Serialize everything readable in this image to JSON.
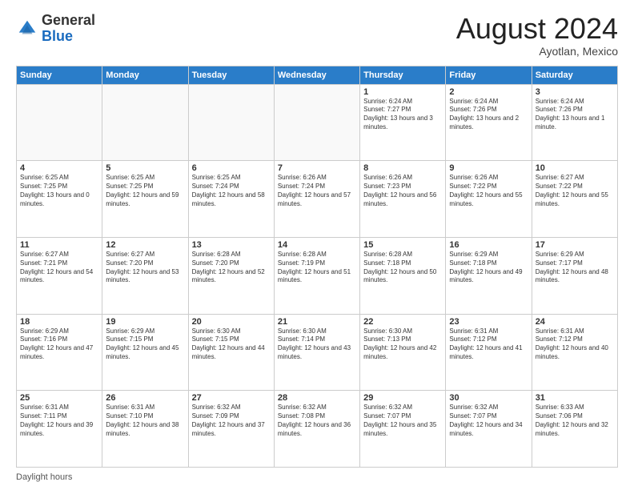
{
  "header": {
    "logo_general": "General",
    "logo_blue": "Blue",
    "month_title": "August 2024",
    "location": "Ayotlan, Mexico"
  },
  "footer": {
    "label": "Daylight hours"
  },
  "days_of_week": [
    "Sunday",
    "Monday",
    "Tuesday",
    "Wednesday",
    "Thursday",
    "Friday",
    "Saturday"
  ],
  "weeks": [
    [
      {
        "day": "",
        "sunrise": "",
        "sunset": "",
        "daylight": ""
      },
      {
        "day": "",
        "sunrise": "",
        "sunset": "",
        "daylight": ""
      },
      {
        "day": "",
        "sunrise": "",
        "sunset": "",
        "daylight": ""
      },
      {
        "day": "",
        "sunrise": "",
        "sunset": "",
        "daylight": ""
      },
      {
        "day": "1",
        "sunrise": "Sunrise: 6:24 AM",
        "sunset": "Sunset: 7:27 PM",
        "daylight": "Daylight: 13 hours and 3 minutes."
      },
      {
        "day": "2",
        "sunrise": "Sunrise: 6:24 AM",
        "sunset": "Sunset: 7:26 PM",
        "daylight": "Daylight: 13 hours and 2 minutes."
      },
      {
        "day": "3",
        "sunrise": "Sunrise: 6:24 AM",
        "sunset": "Sunset: 7:26 PM",
        "daylight": "Daylight: 13 hours and 1 minute."
      }
    ],
    [
      {
        "day": "4",
        "sunrise": "Sunrise: 6:25 AM",
        "sunset": "Sunset: 7:25 PM",
        "daylight": "Daylight: 13 hours and 0 minutes."
      },
      {
        "day": "5",
        "sunrise": "Sunrise: 6:25 AM",
        "sunset": "Sunset: 7:25 PM",
        "daylight": "Daylight: 12 hours and 59 minutes."
      },
      {
        "day": "6",
        "sunrise": "Sunrise: 6:25 AM",
        "sunset": "Sunset: 7:24 PM",
        "daylight": "Daylight: 12 hours and 58 minutes."
      },
      {
        "day": "7",
        "sunrise": "Sunrise: 6:26 AM",
        "sunset": "Sunset: 7:24 PM",
        "daylight": "Daylight: 12 hours and 57 minutes."
      },
      {
        "day": "8",
        "sunrise": "Sunrise: 6:26 AM",
        "sunset": "Sunset: 7:23 PM",
        "daylight": "Daylight: 12 hours and 56 minutes."
      },
      {
        "day": "9",
        "sunrise": "Sunrise: 6:26 AM",
        "sunset": "Sunset: 7:22 PM",
        "daylight": "Daylight: 12 hours and 55 minutes."
      },
      {
        "day": "10",
        "sunrise": "Sunrise: 6:27 AM",
        "sunset": "Sunset: 7:22 PM",
        "daylight": "Daylight: 12 hours and 55 minutes."
      }
    ],
    [
      {
        "day": "11",
        "sunrise": "Sunrise: 6:27 AM",
        "sunset": "Sunset: 7:21 PM",
        "daylight": "Daylight: 12 hours and 54 minutes."
      },
      {
        "day": "12",
        "sunrise": "Sunrise: 6:27 AM",
        "sunset": "Sunset: 7:20 PM",
        "daylight": "Daylight: 12 hours and 53 minutes."
      },
      {
        "day": "13",
        "sunrise": "Sunrise: 6:28 AM",
        "sunset": "Sunset: 7:20 PM",
        "daylight": "Daylight: 12 hours and 52 minutes."
      },
      {
        "day": "14",
        "sunrise": "Sunrise: 6:28 AM",
        "sunset": "Sunset: 7:19 PM",
        "daylight": "Daylight: 12 hours and 51 minutes."
      },
      {
        "day": "15",
        "sunrise": "Sunrise: 6:28 AM",
        "sunset": "Sunset: 7:18 PM",
        "daylight": "Daylight: 12 hours and 50 minutes."
      },
      {
        "day": "16",
        "sunrise": "Sunrise: 6:29 AM",
        "sunset": "Sunset: 7:18 PM",
        "daylight": "Daylight: 12 hours and 49 minutes."
      },
      {
        "day": "17",
        "sunrise": "Sunrise: 6:29 AM",
        "sunset": "Sunset: 7:17 PM",
        "daylight": "Daylight: 12 hours and 48 minutes."
      }
    ],
    [
      {
        "day": "18",
        "sunrise": "Sunrise: 6:29 AM",
        "sunset": "Sunset: 7:16 PM",
        "daylight": "Daylight: 12 hours and 47 minutes."
      },
      {
        "day": "19",
        "sunrise": "Sunrise: 6:29 AM",
        "sunset": "Sunset: 7:15 PM",
        "daylight": "Daylight: 12 hours and 45 minutes."
      },
      {
        "day": "20",
        "sunrise": "Sunrise: 6:30 AM",
        "sunset": "Sunset: 7:15 PM",
        "daylight": "Daylight: 12 hours and 44 minutes."
      },
      {
        "day": "21",
        "sunrise": "Sunrise: 6:30 AM",
        "sunset": "Sunset: 7:14 PM",
        "daylight": "Daylight: 12 hours and 43 minutes."
      },
      {
        "day": "22",
        "sunrise": "Sunrise: 6:30 AM",
        "sunset": "Sunset: 7:13 PM",
        "daylight": "Daylight: 12 hours and 42 minutes."
      },
      {
        "day": "23",
        "sunrise": "Sunrise: 6:31 AM",
        "sunset": "Sunset: 7:12 PM",
        "daylight": "Daylight: 12 hours and 41 minutes."
      },
      {
        "day": "24",
        "sunrise": "Sunrise: 6:31 AM",
        "sunset": "Sunset: 7:12 PM",
        "daylight": "Daylight: 12 hours and 40 minutes."
      }
    ],
    [
      {
        "day": "25",
        "sunrise": "Sunrise: 6:31 AM",
        "sunset": "Sunset: 7:11 PM",
        "daylight": "Daylight: 12 hours and 39 minutes."
      },
      {
        "day": "26",
        "sunrise": "Sunrise: 6:31 AM",
        "sunset": "Sunset: 7:10 PM",
        "daylight": "Daylight: 12 hours and 38 minutes."
      },
      {
        "day": "27",
        "sunrise": "Sunrise: 6:32 AM",
        "sunset": "Sunset: 7:09 PM",
        "daylight": "Daylight: 12 hours and 37 minutes."
      },
      {
        "day": "28",
        "sunrise": "Sunrise: 6:32 AM",
        "sunset": "Sunset: 7:08 PM",
        "daylight": "Daylight: 12 hours and 36 minutes."
      },
      {
        "day": "29",
        "sunrise": "Sunrise: 6:32 AM",
        "sunset": "Sunset: 7:07 PM",
        "daylight": "Daylight: 12 hours and 35 minutes."
      },
      {
        "day": "30",
        "sunrise": "Sunrise: 6:32 AM",
        "sunset": "Sunset: 7:07 PM",
        "daylight": "Daylight: 12 hours and 34 minutes."
      },
      {
        "day": "31",
        "sunrise": "Sunrise: 6:33 AM",
        "sunset": "Sunset: 7:06 PM",
        "daylight": "Daylight: 12 hours and 32 minutes."
      }
    ]
  ]
}
